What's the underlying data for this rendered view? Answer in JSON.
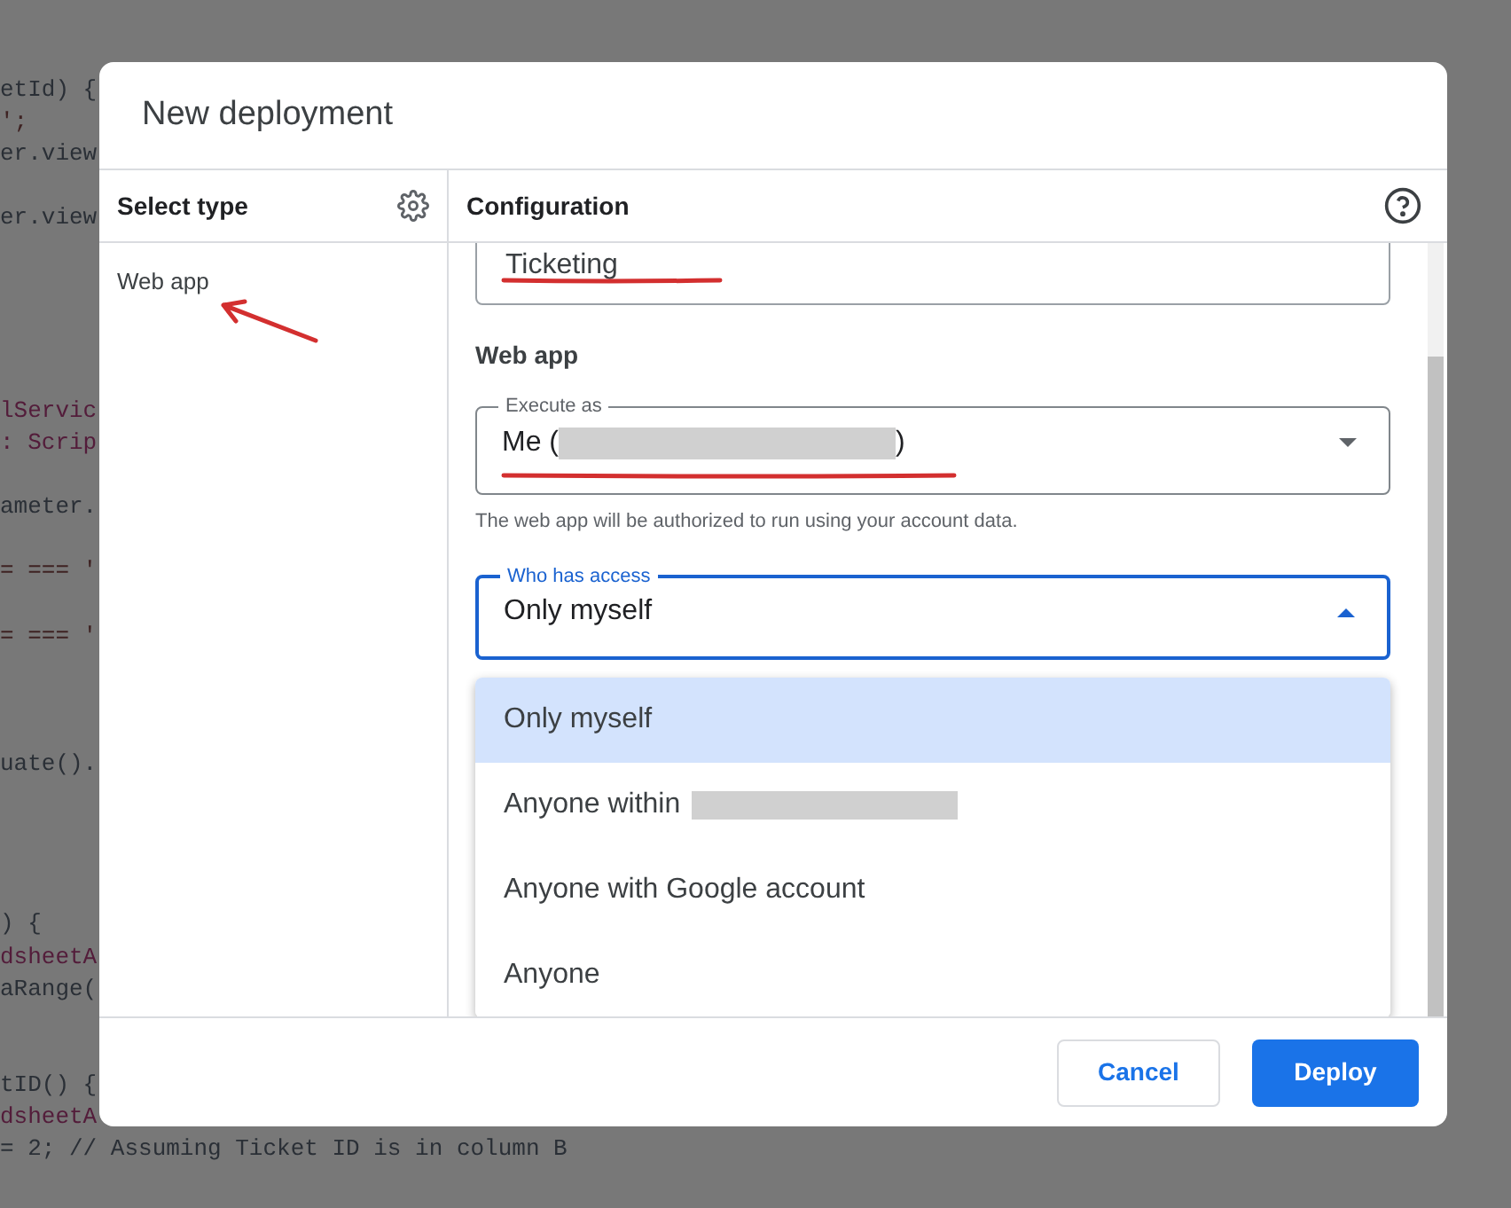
{
  "background_code": [
    {
      "kind": "plain",
      "text": "etId) {"
    },
    {
      "kind": "string",
      "text": "';"
    },
    {
      "kind": "plain",
      "text": "er.view"
    },
    {
      "kind": "blank"
    },
    {
      "kind": "plain",
      "text": "er.view"
    },
    {
      "kind": "blank"
    },
    {
      "kind": "blank"
    },
    {
      "kind": "blank"
    },
    {
      "kind": "blank"
    },
    {
      "kind": "blank"
    },
    {
      "kind": "keyword",
      "text": "lServic"
    },
    {
      "kind": "keyword",
      "text": ": Scrip"
    },
    {
      "kind": "blank"
    },
    {
      "kind": "plain",
      "text": "ameter."
    },
    {
      "kind": "blank"
    },
    {
      "kind": "string",
      "text": "= === '"
    },
    {
      "kind": "blank"
    },
    {
      "kind": "string",
      "text": "= === '"
    },
    {
      "kind": "blank"
    },
    {
      "kind": "blank"
    },
    {
      "kind": "blank"
    },
    {
      "kind": "plain",
      "text": "uate()."
    },
    {
      "kind": "blank"
    },
    {
      "kind": "blank"
    },
    {
      "kind": "blank"
    },
    {
      "kind": "blank"
    },
    {
      "kind": "plain",
      "text": ") {"
    },
    {
      "kind": "keyword",
      "text": "dsheetA"
    },
    {
      "kind": "plain",
      "text": "aRange("
    },
    {
      "kind": "blank"
    },
    {
      "kind": "blank"
    },
    {
      "kind": "plain",
      "text": "tID() {"
    },
    {
      "kind": "keyword",
      "text": "dsheetA"
    },
    {
      "kind": "plain",
      "text": "= 2; // Assuming Ticket ID is in column B"
    }
  ],
  "dialog": {
    "title": "New deployment",
    "select_type": {
      "heading": "Select type",
      "items": [
        {
          "label": "Web app"
        }
      ]
    },
    "configuration": {
      "heading": "Configuration",
      "name_value": "Ticketing",
      "section": "Web app",
      "execute_as": {
        "label": "Execute as",
        "value_prefix": "Me (",
        "value_suffix": ")"
      },
      "helper": "The web app will be authorized to run using your account data.",
      "who_has_access": {
        "label": "Who has access",
        "value": "Only myself",
        "expanded": true,
        "options": [
          {
            "label": "Only myself",
            "selected": true,
            "redacted": false
          },
          {
            "label": "Anyone within",
            "selected": false,
            "redacted": true
          },
          {
            "label": "Anyone with Google account",
            "selected": false,
            "redacted": false
          },
          {
            "label": "Anyone",
            "selected": false,
            "redacted": false
          }
        ]
      }
    },
    "buttons": [
      {
        "label": "Cancel",
        "kind": "secondary"
      },
      {
        "label": "Deploy",
        "kind": "primary"
      }
    ]
  }
}
